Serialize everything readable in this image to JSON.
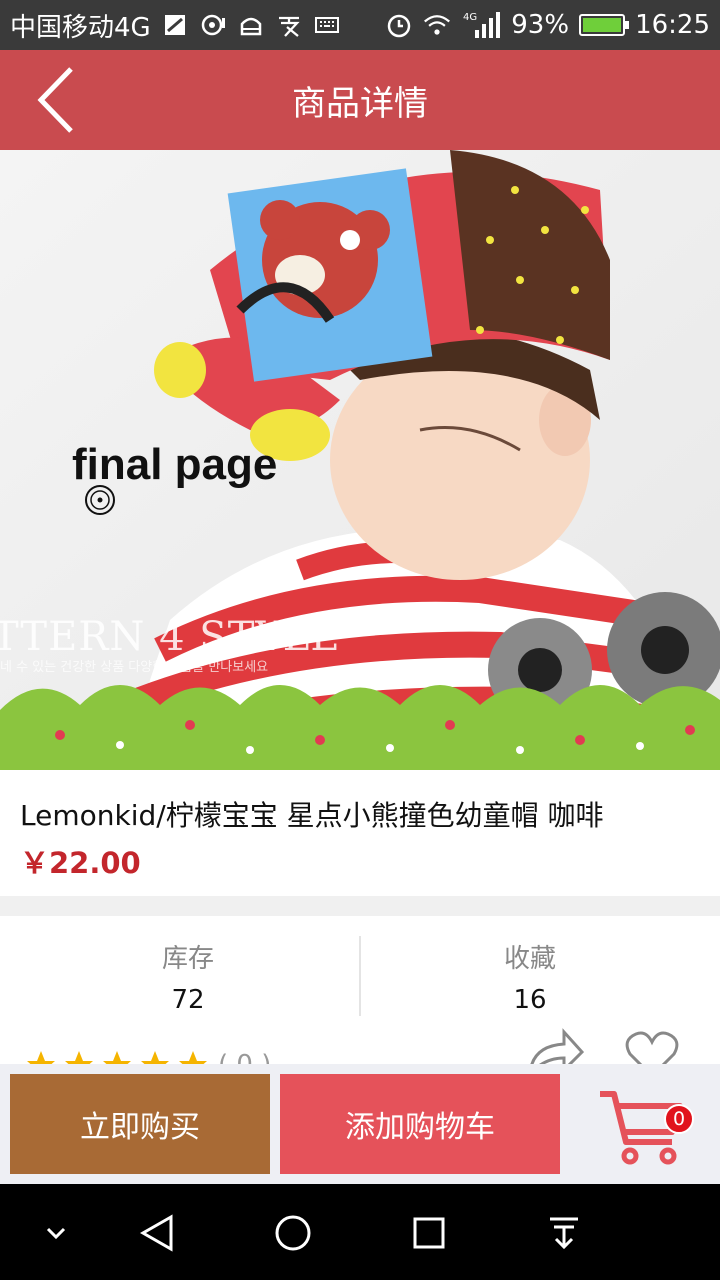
{
  "status_bar": {
    "carrier": "中国移动4G",
    "network": "4G",
    "battery": "93%",
    "battery_level": 0.93,
    "time": "16:25"
  },
  "header": {
    "title": "商品详情",
    "back_icon": "chevron-left-icon"
  },
  "product_image": {
    "overlay_text": "final page",
    "watermark": "TTERN 4 STYLE",
    "watermark_sub": "네 수 있는 건강한 상품 다양한 제품을 만나보세요"
  },
  "product": {
    "name": "Lemonkid/柠檬宝宝 星点小熊撞色幼童帽 咖啡",
    "price": "￥22.00"
  },
  "stats": {
    "stock_label": "库存",
    "stock_value": "72",
    "favorites_label": "收藏",
    "favorites_value": "16",
    "rating_count": "( 0 )"
  },
  "actions": {
    "buy_now": "立即购买",
    "add_to_cart": "添加购物车",
    "cart_badge": "0"
  },
  "colors": {
    "header": "#c94b4f",
    "buy_now": "#a86a35",
    "add_to_cart": "#e5525a",
    "price": "#c3262c",
    "star": "#f5b400"
  },
  "nav": {
    "icons": [
      "chevron-down-icon",
      "back-triangle-icon",
      "home-circle-icon",
      "recents-square-icon",
      "notification-pull-icon"
    ]
  }
}
